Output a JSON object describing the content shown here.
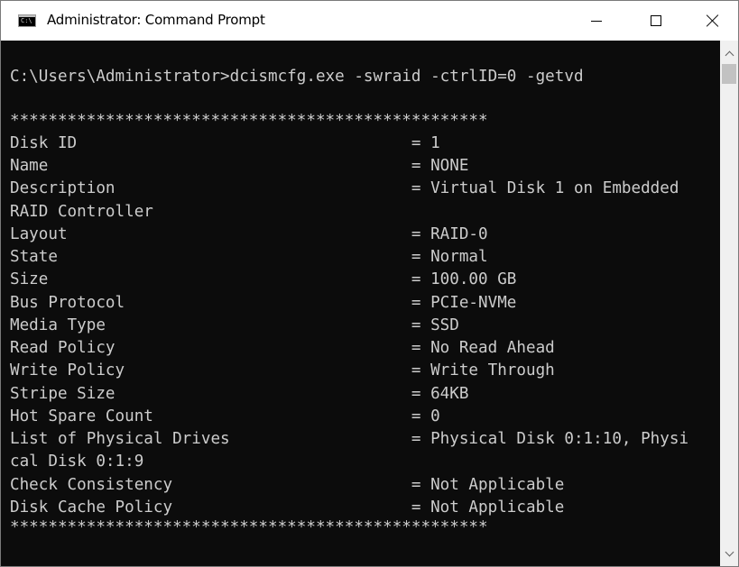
{
  "window": {
    "title": "Administrator: Command Prompt",
    "icon": "console-icon",
    "icon_glyph": "C:\\"
  },
  "controls": {
    "minimize": "minimize-icon",
    "maximize": "maximize-icon",
    "close": "close-icon"
  },
  "console": {
    "lines": [
      "C:\\Users\\Administrator>dcismcfg.exe -swraid -ctrlID=0 -getvd",
      "",
      "**************************************************",
      "Disk ID                                   = 1",
      "Name                                      = NONE",
      "Description                               = Virtual Disk 1 on Embedded",
      "RAID Controller",
      "Layout                                    = RAID-0",
      "State                                     = Normal",
      "Size                                      = 100.00 GB",
      "Bus Protocol                              = PCIe-NVMe",
      "Media Type                                = SSD",
      "Read Policy                               = No Read Ahead",
      "Write Policy                              = Write Through",
      "Stripe Size                               = 64KB",
      "Hot Spare Count                           = 0",
      "List of Physical Drives                   = Physical Disk 0:1:10, Physi",
      "cal Disk 0:1:9",
      "Check Consistency                         = Not Applicable",
      "Disk Cache Policy                         = Not Applicable",
      "**************************************************"
    ]
  },
  "colors": {
    "console_bg": "#0c0c0c",
    "console_fg": "#cccccc",
    "titlebar_bg": "#ffffff"
  }
}
